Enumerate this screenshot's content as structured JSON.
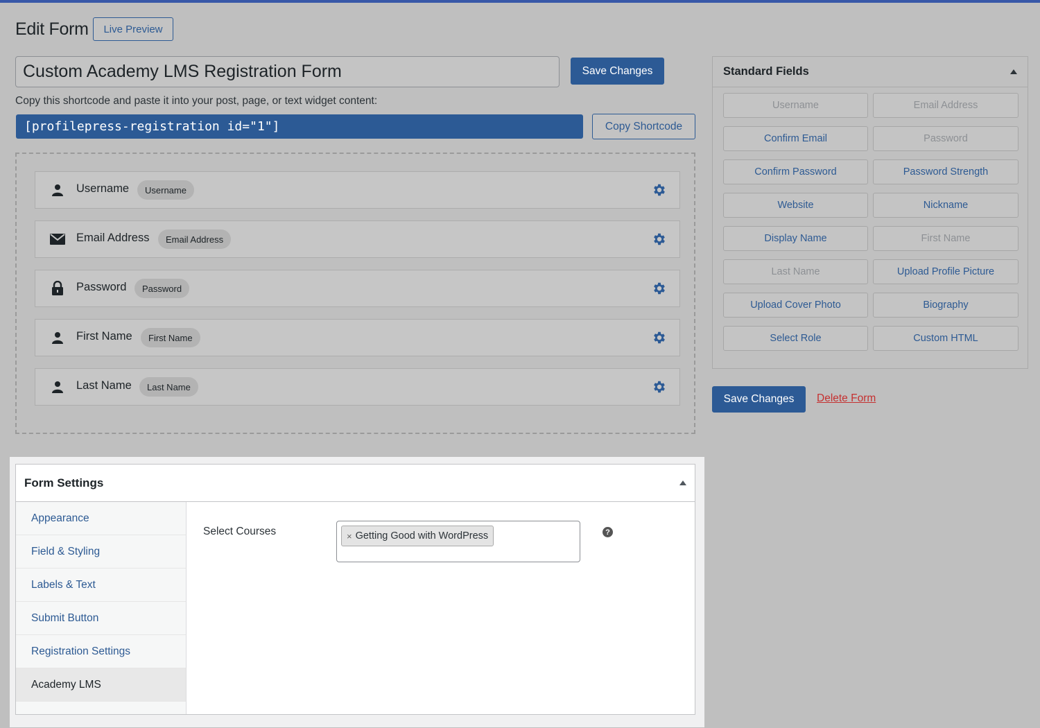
{
  "page": {
    "title": "Edit Form",
    "live_preview_label": "Live Preview"
  },
  "form": {
    "title_value": "Custom Academy LMS Registration Form",
    "save_label": "Save Changes",
    "shortcode_help": "Copy this shortcode and paste it into your post, page, or text widget content:",
    "shortcode": "[profilepress-registration id=\"1\"]",
    "copy_shortcode_label": "Copy Shortcode"
  },
  "builder": {
    "fields": [
      {
        "label": "Username",
        "badge": "Username",
        "icon": "user-icon"
      },
      {
        "label": "Email Address",
        "badge": "Email Address",
        "icon": "envelope-icon"
      },
      {
        "label": "Password",
        "badge": "Password",
        "icon": "lock-icon"
      },
      {
        "label": "First Name",
        "badge": "First Name",
        "icon": "user-icon"
      },
      {
        "label": "Last Name",
        "badge": "Last Name",
        "icon": "user-icon"
      }
    ]
  },
  "standard_fields": {
    "title": "Standard Fields",
    "buttons": [
      {
        "label": "Username",
        "enabled": false
      },
      {
        "label": "Email Address",
        "enabled": false
      },
      {
        "label": "Confirm Email",
        "enabled": true
      },
      {
        "label": "Password",
        "enabled": false
      },
      {
        "label": "Confirm Password",
        "enabled": true
      },
      {
        "label": "Password Strength",
        "enabled": true
      },
      {
        "label": "Website",
        "enabled": true
      },
      {
        "label": "Nickname",
        "enabled": true
      },
      {
        "label": "Display Name",
        "enabled": true
      },
      {
        "label": "First Name",
        "enabled": false
      },
      {
        "label": "Last Name",
        "enabled": false
      },
      {
        "label": "Upload Profile Picture",
        "enabled": true
      },
      {
        "label": "Upload Cover Photo",
        "enabled": true
      },
      {
        "label": "Biography",
        "enabled": true
      },
      {
        "label": "Select Role",
        "enabled": true
      },
      {
        "label": "Custom HTML",
        "enabled": true
      }
    ]
  },
  "actions": {
    "save_label": "Save Changes",
    "delete_label": "Delete Form"
  },
  "form_settings": {
    "title": "Form Settings",
    "tabs": [
      {
        "label": "Appearance",
        "active": false
      },
      {
        "label": "Field & Styling",
        "active": false
      },
      {
        "label": "Labels & Text",
        "active": false
      },
      {
        "label": "Submit Button",
        "active": false
      },
      {
        "label": "Registration Settings",
        "active": false
      },
      {
        "label": "Academy LMS",
        "active": true
      }
    ],
    "select_courses_label": "Select Courses",
    "selected_course": "Getting Good with WordPress",
    "chip_remove": "×",
    "help_glyph": "?"
  },
  "colors": {
    "accent": "#2c5a95",
    "danger": "#c53030",
    "top_bar": "#3858a8"
  }
}
